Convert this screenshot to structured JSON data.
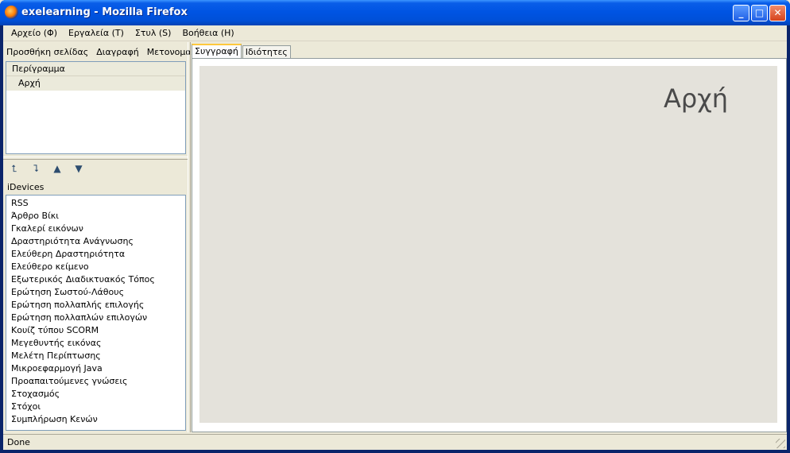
{
  "window": {
    "title": "exelearning - Mozilla Firefox",
    "min_glyph": "_",
    "max_glyph": "□",
    "close_glyph": "✕"
  },
  "menu": [
    "Αρχείο (Φ)",
    "Εργαλεία (Τ)",
    "Στυλ (S)",
    "Βοήθεια (Η)"
  ],
  "outline": {
    "toolbar": [
      "Προσθήκη σελίδας",
      "Διαγραφή",
      "Μετονομασία"
    ],
    "header": "Περίγραμμα",
    "nodes": [
      "Αρχή"
    ]
  },
  "arrows": {
    "promote": "⮤",
    "demote": "⮧",
    "up": "▲",
    "down": "▼"
  },
  "idevices": {
    "label": "iDevices",
    "items": [
      "RSS",
      "Άρθρο Βίκι",
      "Γκαλερί εικόνων",
      "Δραστηριότητα Ανάγνωσης",
      "Ελεύθερη Δραστηριότητα",
      "Ελεύθερο κείμενο",
      "Εξωτερικός Διαδικτυακός Τόπος",
      "Ερώτηση Σωστού-Λάθους",
      "Ερώτηση πολλαπλής επιλογής",
      "Ερώτηση πολλαπλών επιλογών",
      "Κουίζ τύπου SCORM",
      "Μεγεθυντής εικόνας",
      "Μελέτη Περίπτωσης",
      "Μικροεφαρμογή Java",
      "Προαπαιτούμενες γνώσεις",
      "Στοχασμός",
      "Στόχοι",
      "Συμπλήρωση Κενών"
    ]
  },
  "tabs": [
    "Συγγραφή",
    "Ιδιότητες"
  ],
  "content": {
    "heading": "Αρχή"
  },
  "status": {
    "text": "Done"
  }
}
